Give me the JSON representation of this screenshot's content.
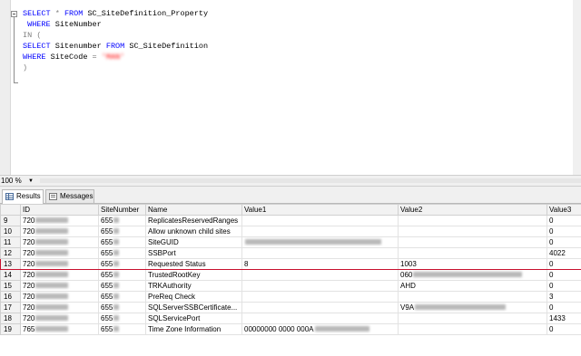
{
  "editor": {
    "lines": {
      "l1_kw": "SELECT",
      "l1_star": "*",
      "l1_from": "FROM",
      "l1_table": "SC_SiteDefinition_Property",
      "l2_where": "WHERE",
      "l2_col": "SiteNumber",
      "l3_in": "IN",
      "l3_paren": "(",
      "l4_select": "SELECT",
      "l4_col": "Sitenumber",
      "l4_from": "FROM",
      "l4_table": "SC_SiteDefinition",
      "l5_where": "WHERE",
      "l5_col": "SiteCode",
      "l5_eq": "=",
      "l5_value": "'MAN'",
      "l6_paren": ")"
    }
  },
  "zoom": {
    "value": "100 %",
    "arrow": "▼"
  },
  "tabs": [
    {
      "label": "Results",
      "icon": "grid-icon"
    },
    {
      "label": "Messages",
      "icon": "messages-icon"
    }
  ],
  "grid": {
    "headers": [
      "ID",
      "SiteNumber",
      "Name",
      "Value1",
      "Value2",
      "Value3"
    ],
    "rows": [
      {
        "n": "9",
        "id": "720",
        "site": "655",
        "name": "ReplicatesReservedRanges",
        "v1": "",
        "v2": "",
        "v3": "0"
      },
      {
        "n": "10",
        "id": "720",
        "site": "655",
        "name": "Allow unknown child sites",
        "v1": "",
        "v2": "",
        "v3": "0"
      },
      {
        "n": "11",
        "id": "720",
        "site": "655",
        "name": "SiteGUID",
        "v1": "",
        "v2": "",
        "v3": "0"
      },
      {
        "n": "12",
        "id": "720",
        "site": "655",
        "name": "SSBPort",
        "v1": "",
        "v2": "",
        "v3": "4022"
      },
      {
        "n": "13",
        "id": "720",
        "site": "655",
        "name": "Requested Status",
        "v1": "8",
        "v2": "1003",
        "v3": "0"
      },
      {
        "n": "14",
        "id": "720",
        "site": "655",
        "name": "TrustedRootKey",
        "v1": "",
        "v2": "060",
        "v3": "0"
      },
      {
        "n": "15",
        "id": "720",
        "site": "655",
        "name": "TRKAuthority",
        "v1": "",
        "v2": "AHD",
        "v3": "0"
      },
      {
        "n": "16",
        "id": "720",
        "site": "655",
        "name": "PreReq Check",
        "v1": "",
        "v2": "",
        "v3": "3"
      },
      {
        "n": "17",
        "id": "720",
        "site": "655",
        "name": "SQLServerSSBCertificate...",
        "v1": "",
        "v2": "V9A",
        "v3": "0"
      },
      {
        "n": "18",
        "id": "720",
        "site": "655",
        "name": "SQLServicePort",
        "v1": "",
        "v2": "",
        "v3": "1433"
      },
      {
        "n": "19",
        "id": "765",
        "site": "655",
        "name": "Time Zone Information",
        "v1": "00000000 0000 000A",
        "v2": "",
        "v3": "0"
      }
    ]
  },
  "colors": {
    "keyword": "#0000ff",
    "string": "#ff0000",
    "highlight": "#c8102e"
  }
}
